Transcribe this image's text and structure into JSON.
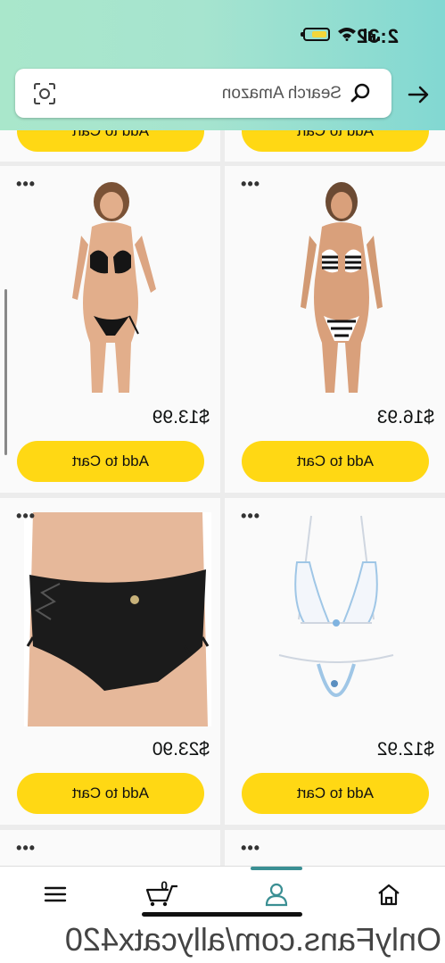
{
  "status_bar": {
    "time": "2:32"
  },
  "search": {
    "placeholder": "Search Amazon"
  },
  "products": [
    {
      "price": "$16.93",
      "button": "Add to Cart",
      "more": "•••",
      "image": "striped-bikini"
    },
    {
      "price": "$13.99",
      "button": "Add to Cart",
      "more": "•••",
      "image": "black-bikini"
    },
    {
      "price": "$12.92",
      "button": "Add to Cart",
      "more": "•••",
      "image": "white-lace-lingerie"
    },
    {
      "price": "$23.90",
      "button": "Add to Cart",
      "more": "•••",
      "image": "denim-shorts"
    }
  ],
  "top_row_button": "Add to Cart",
  "bottom_nav": {
    "cart_count": "0",
    "items": [
      "home-icon",
      "user-icon",
      "cart-icon",
      "menu-icon"
    ],
    "active_color": "#3a8f93"
  },
  "watermark": "OnlyFans.com/allycatx420"
}
